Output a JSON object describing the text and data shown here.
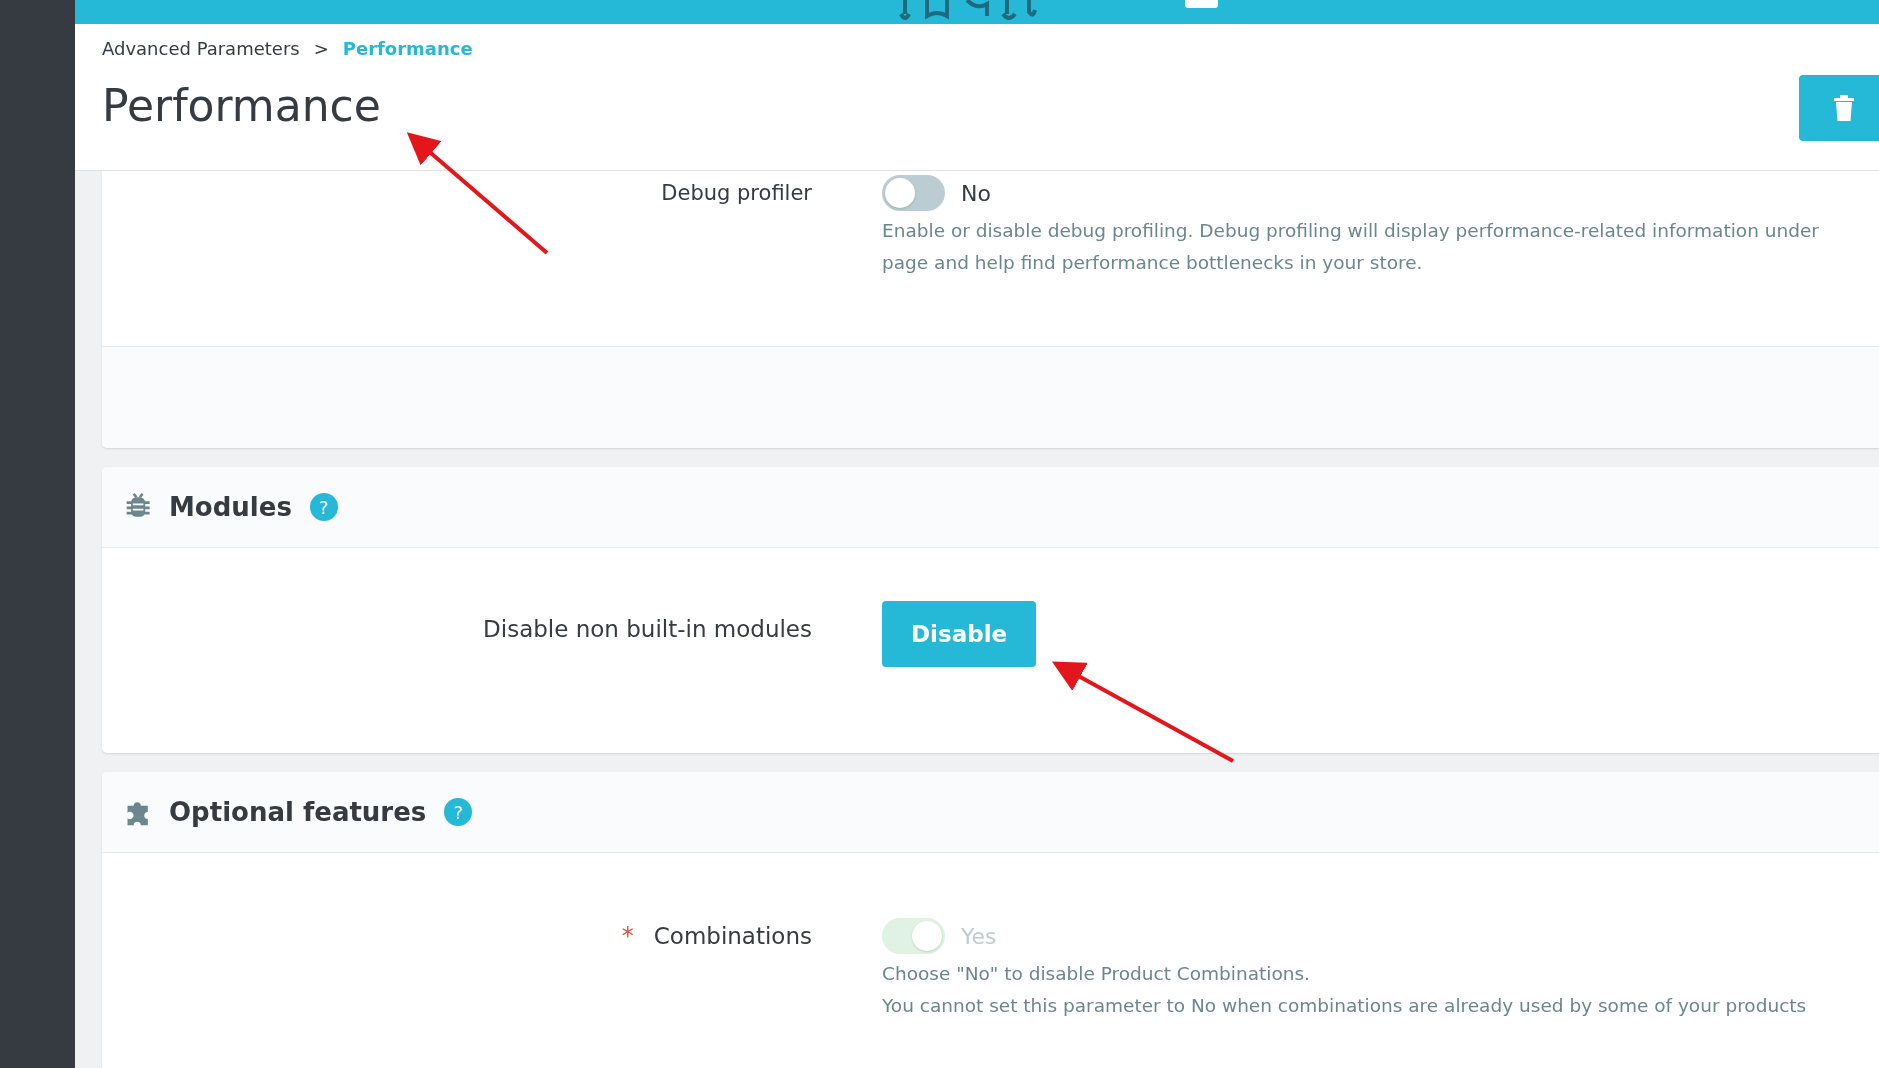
{
  "breadcrumb": [
    {
      "label": "Advanced Parameters",
      "current": false
    },
    {
      "label": "Performance",
      "current": true
    }
  ],
  "breadcrumb_separator": ">",
  "page_title": "Performance",
  "debug_profiler": {
    "label": "Debug profiler",
    "on": false,
    "disabled": false,
    "value_label": "No",
    "help": [
      "Enable or disable debug profiling. Debug profiling will display performance-related information under",
      "page and help find performance bottlenecks in your store."
    ]
  },
  "sections": [
    {
      "title": "Modules",
      "help_icon": "?",
      "rows": [
        {
          "kind": "button",
          "label": "Disable non built-in modules",
          "button": "Disable"
        }
      ]
    },
    {
      "title": "Optional features",
      "help_icon": "?",
      "rows": [
        {
          "kind": "toggle",
          "label": "Combinations",
          "required": true,
          "required_marker": "*",
          "on": true,
          "disabled": true,
          "value_label": "Yes",
          "help": [
            "Choose \"No\" to disable Product Combinations.",
            "You cannot set this parameter to No when combinations are already used by some of your products"
          ]
        }
      ]
    }
  ]
}
